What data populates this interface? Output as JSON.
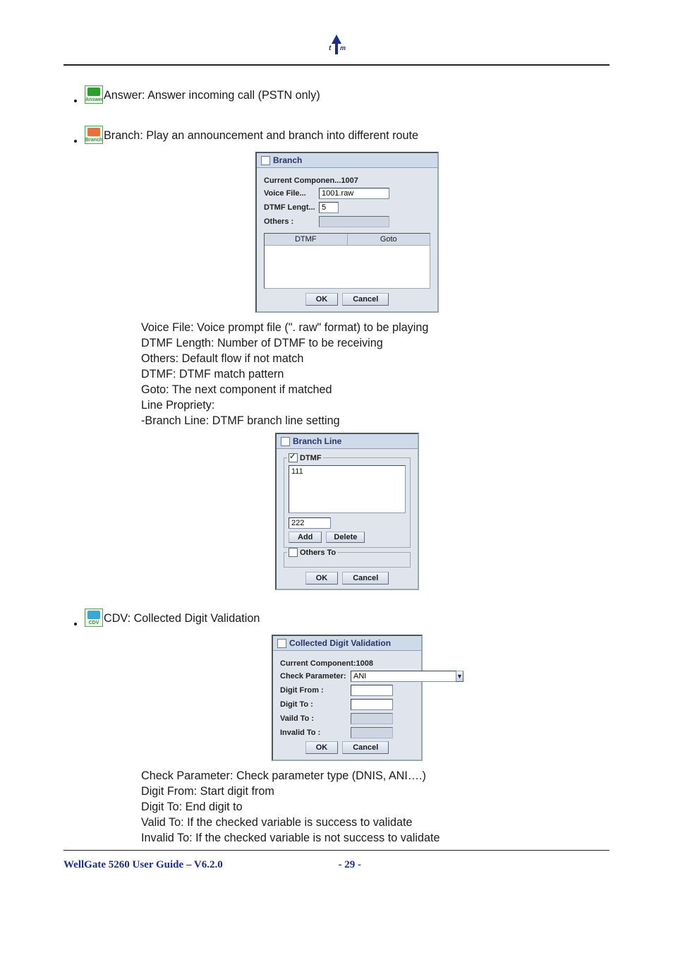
{
  "bullet1": {
    "icon_caption": "Answer",
    "text": "Answer: Answer incoming call (PSTN only)"
  },
  "bullet2": {
    "icon_caption": "Branch",
    "text": "Branch: Play an announcement and branch into different route"
  },
  "branch_dlg": {
    "title": "Branch",
    "current_label": "Current Componen...",
    "current_value": "1007",
    "voice_file_label": "Voice File...",
    "voice_file_value": "1001.raw",
    "dtmf_len_label": "DTMF Lengt...",
    "dtmf_len_value": "5",
    "others_label": "Others :",
    "col1": "DTMF",
    "col2": "Goto",
    "ok": "OK",
    "cancel": "Cancel"
  },
  "branch_desc": {
    "l1": "Voice File: Voice prompt file (\". raw\" format) to be playing",
    "l2": "DTMF Length: Number of DTMF to be receiving",
    "l3": "Others: Default flow if not match",
    "l4": "DTMF: DTMF match pattern",
    "l5": "Goto: The next component if matched",
    "l6": "Line Propriety:",
    "l7": " -Branch Line: DTMF branch line setting"
  },
  "branchline_dlg": {
    "title": "Branch Line",
    "dtmf_label": "DTMF",
    "list_value": "111",
    "input_value": "222",
    "add": "Add",
    "delete": "Delete",
    "others_to_label": "Others To",
    "ok": "OK",
    "cancel": "Cancel"
  },
  "bullet3": {
    "icon_caption": "CDV",
    "text": "CDV: Collected Digit Validation"
  },
  "cdv_dlg": {
    "title": "Collected Digit Validation",
    "current_label": "Current Component:",
    "current_value": "1008",
    "check_param_label": "Check Parameter:",
    "check_param_value": "ANI",
    "digit_from_label": "Digit From :",
    "digit_to_label": "Digit To :",
    "valid_to_label": "Vaild To :",
    "invalid_to_label": "Invalid To :",
    "ok": "OK",
    "cancel": "Cancel"
  },
  "cdv_desc": {
    "l1": "Check Parameter: Check parameter type (DNIS, ANI….)",
    "l2": "Digit From: Start digit from",
    "l3": "Digit To: End digit to",
    "l4": "Valid To: If the checked variable is success to validate",
    "l5": "Invalid To: If the checked variable is not success to validate"
  },
  "footer": {
    "title": "WellGate 5260 User Guide – V6.2.0",
    "page": "- 29 -"
  }
}
